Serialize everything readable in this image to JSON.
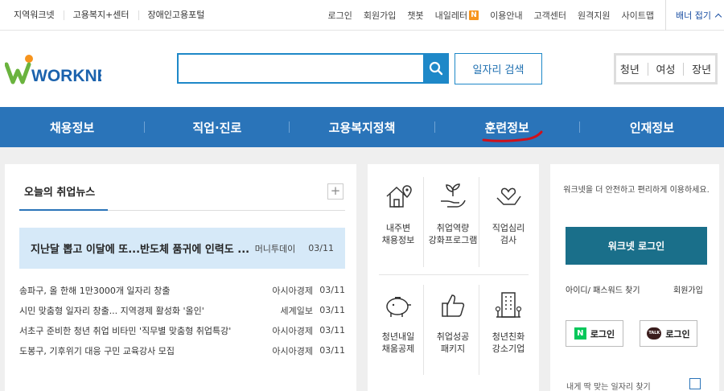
{
  "topbar": {
    "left_links": [
      "지역워크넷",
      "고용복지+센터",
      "장애인고용포털"
    ],
    "right_links": [
      "로그인",
      "회원가입",
      "챗봇",
      "내일레터",
      "이용안내",
      "고객센터",
      "원격지원",
      "사이트맵"
    ],
    "new_badge": "N",
    "banner_toggle": "배너 접기"
  },
  "header": {
    "logo_text": "WORKNET",
    "search_placeholder": "",
    "job_search_label": "일자리 검색",
    "age_tabs": [
      "청년",
      "여성",
      "장년"
    ]
  },
  "main_nav": {
    "items": [
      "채용정보",
      "직업·진로",
      "고용복지정책",
      "훈련정보",
      "인재정보"
    ],
    "highlighted_index": 3
  },
  "news": {
    "tab_title": "오늘의 취업뉴스",
    "more_label": "+",
    "headline": {
      "title": "지난달 뽑고 이달에 또...반도체 품귀에 인력도 ...",
      "source": "머니투데이",
      "date": "03/11"
    },
    "items": [
      {
        "title": "송파구, 올 한해 1만3000개 일자리 창출",
        "source": "아시아경제",
        "date": "03/11"
      },
      {
        "title": "시민 맞춤형 일자리 창출... 지역경제 활성화 '올인'",
        "source": "세계일보",
        "date": "03/11"
      },
      {
        "title": "서초구 준비한 청년 취업 비타민 '직무별 맞춤형 취업특강'",
        "source": "아시아경제",
        "date": "03/11"
      },
      {
        "title": "도봉구, 기후위기 대응 구민 교육강사 모집",
        "source": "아시아경제",
        "date": "03/11"
      }
    ]
  },
  "services": {
    "items": [
      {
        "line1": "내주변",
        "line2": "채용정보",
        "icon": "house-location-icon"
      },
      {
        "line1": "취업역량",
        "line2": "강화프로그램",
        "icon": "hand-sprout-icon"
      },
      {
        "line1": "직업심리",
        "line2": "검사",
        "icon": "hand-heart-icon"
      },
      {
        "line1": "청년내일",
        "line2": "채움공제",
        "icon": "piggy-bank-icon"
      },
      {
        "line1": "취업성공",
        "line2": "패키지",
        "icon": "thumbs-up-icon"
      },
      {
        "line1": "청년친화",
        "line2": "강소기업",
        "icon": "building-icon"
      }
    ]
  },
  "login": {
    "message": "워크넷을 더 안전하고 편리하게 이용하세요.",
    "login_button": "워크넷 로그인",
    "find_label": "아이디/ 패스워드 찾기",
    "join_label": "회원가입",
    "naver_badge": "N",
    "kakao_badge": "TALK",
    "naver_login": "로그인",
    "kakao_login": "로그인",
    "cut_text": "내게 딱 맞는 일자리 찾기"
  },
  "colors": {
    "nav_blue": "#2a74b9",
    "search_blue": "#1e88c8",
    "login_teal": "#1a6f8a",
    "headline_bg": "#d6e9f8",
    "badge_orange": "#f7941d",
    "naver_green": "#03c75a"
  }
}
